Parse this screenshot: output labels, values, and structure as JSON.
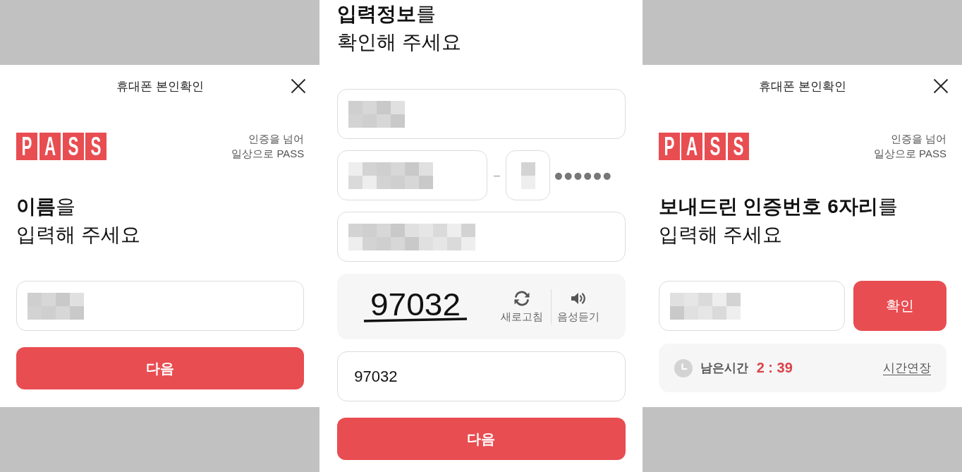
{
  "panels": [
    {
      "kind": "sheet",
      "header": {
        "title": "휴대폰 본인확인"
      },
      "brand": {
        "logo": "P A S S",
        "tagline": [
          "인증을 넘어",
          "일상으로 PASS"
        ]
      },
      "heading": [
        "**이름**을",
        "입력해 주세요"
      ],
      "fields": [
        {
          "kind": "name",
          "redacted": true
        }
      ],
      "next_button": "다음"
    },
    {
      "kind": "page",
      "heading": [
        "**입력정보**를",
        "확인해 주세요"
      ],
      "fields": [
        {
          "kind": "name",
          "redacted": true
        },
        {
          "kind": "resident_number",
          "front": {
            "redacted": true
          },
          "separator": "–",
          "back": {
            "redacted": true
          },
          "masked": "●●●●●●"
        },
        {
          "kind": "phone",
          "redacted": true
        }
      ],
      "captcha": {
        "image_text": "97032",
        "actions": [
          {
            "kind": "refresh",
            "label": "새로고침"
          },
          {
            "kind": "audio",
            "label": "음성듣기"
          }
        ]
      },
      "captcha_input": {
        "value": "97032"
      },
      "next_button": "다음"
    },
    {
      "kind": "sheet",
      "header": {
        "title": "휴대폰 본인확인"
      },
      "brand": {
        "logo": "P A S S",
        "tagline": [
          "인증을 넘어",
          "일상으로 PASS"
        ]
      },
      "heading": [
        "**보내드린 인증번호 6자리**를",
        "입력해 주세요"
      ],
      "code_entry": {
        "field": {
          "redacted": true
        },
        "button": "확인"
      },
      "timer": {
        "label": "남은시간",
        "remaining": "2 : 39",
        "extend_link": "시간연장"
      }
    }
  ]
}
